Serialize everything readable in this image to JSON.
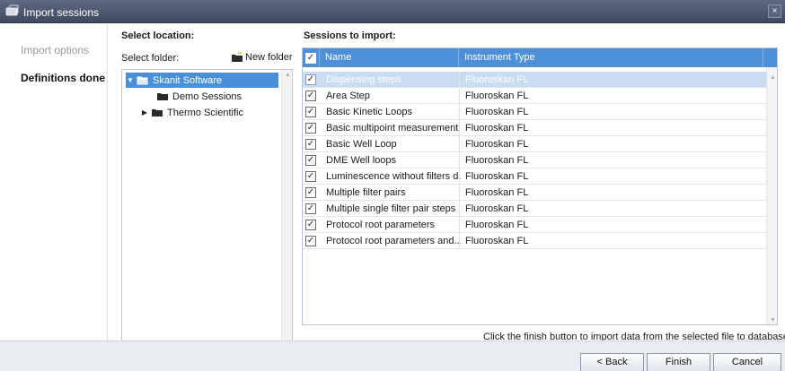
{
  "window": {
    "title": "Import sessions",
    "close_glyph": "×"
  },
  "sidebar": {
    "items": [
      {
        "label": "Import options"
      },
      {
        "label": "Definitions done"
      }
    ]
  },
  "location": {
    "heading": "Select location:",
    "folder_label": "Select folder:",
    "new_folder_label": "New folder",
    "tree": [
      {
        "label": "Skanit Software",
        "expanded": true
      },
      {
        "label": "Demo Sessions"
      },
      {
        "label": "Thermo Scientific",
        "collapsed": true
      }
    ],
    "expanded_glyph": "▼",
    "collapsed_glyph": "▶"
  },
  "sessions": {
    "heading": "Sessions to import:",
    "columns": {
      "name": "Name",
      "type": "Instrument Type"
    },
    "check_glyph": "✓",
    "rows": [
      {
        "name": "Dispensing steps",
        "type": "Fluoroskan FL",
        "checked": true,
        "selected": true
      },
      {
        "name": "Area Step",
        "type": "Fluoroskan FL",
        "checked": true
      },
      {
        "name": "Basic Kinetic Loops",
        "type": "Fluoroskan FL",
        "checked": true
      },
      {
        "name": "Basic multipoint measurement",
        "type": "Fluoroskan FL",
        "checked": true
      },
      {
        "name": "Basic Well Loop",
        "type": "Fluoroskan FL",
        "checked": true
      },
      {
        "name": "DME Well loops",
        "type": "Fluoroskan FL",
        "checked": true
      },
      {
        "name": "Luminescence without filters d...",
        "type": "Fluoroskan FL",
        "checked": true
      },
      {
        "name": "Multiple filter pairs",
        "type": "Fluoroskan FL",
        "checked": true
      },
      {
        "name": "Multiple single filter pair steps",
        "type": "Fluoroskan FL",
        "checked": true
      },
      {
        "name": "Protocol root parameters",
        "type": "Fluoroskan FL",
        "checked": true
      },
      {
        "name": "Protocol root parameters and...",
        "type": "Fluoroskan FL",
        "checked": true
      }
    ]
  },
  "hint": "Click the finish button to import data from the selected file to database",
  "buttons": {
    "back": "< Back",
    "finish": "Finish",
    "cancel": "Cancel"
  },
  "colors": {
    "header_blue": "#4e90d8",
    "selection_blue": "#4a90d9",
    "title_bar": "#4f5a70"
  }
}
